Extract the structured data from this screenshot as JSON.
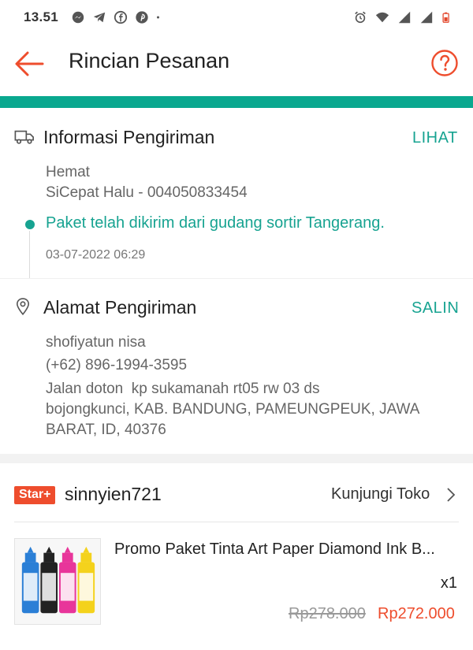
{
  "status_bar": {
    "time": "13.51",
    "left_icons": [
      "messenger-icon",
      "telegram-icon",
      "facebook-icon",
      "pinterest-icon",
      "dot-icon"
    ],
    "right_icons": [
      "alarm-icon",
      "wifi-icon",
      "signal-icon",
      "signal-icon",
      "battery-icon"
    ]
  },
  "appbar": {
    "title": "Rincian Pesanan",
    "back_icon": "arrow-left-icon",
    "help_icon": "help-circle-icon",
    "accent_color": "#ee4d2d"
  },
  "shipping_info": {
    "title": "Informasi Pengiriman",
    "action": "LIHAT",
    "service": "Hemat",
    "courier": "SiCepat Halu - 004050833454",
    "status": "Paket telah dikirim dari gudang sortir Tangerang.",
    "datetime": "03-07-2022 06:29",
    "status_color": "#17a391"
  },
  "shipping_address": {
    "title": "Alamat Pengiriman",
    "action": "SALIN",
    "name": "shofiyatun nisa",
    "phone": "(+62) 896-1994-3595",
    "address_line1": "Jalan doton  kp sukamanah rt05 rw 03 ds",
    "address_line2": "bojongkunci, KAB. BANDUNG, PAMEUNGPEUK, JAWA",
    "address_line3": "BARAT, ID, 40376"
  },
  "shop": {
    "badge": "Star+",
    "name": "sinnyien721",
    "visit_label": "Kunjungi Toko"
  },
  "product": {
    "name": "Promo Paket Tinta Art Paper Diamond Ink B...",
    "quantity": "x1",
    "original_price": "Rp278.000",
    "price": "Rp272.000",
    "bottle_colors": [
      "#2b7fd6",
      "#222222",
      "#e8359a",
      "#f4d21c"
    ]
  }
}
